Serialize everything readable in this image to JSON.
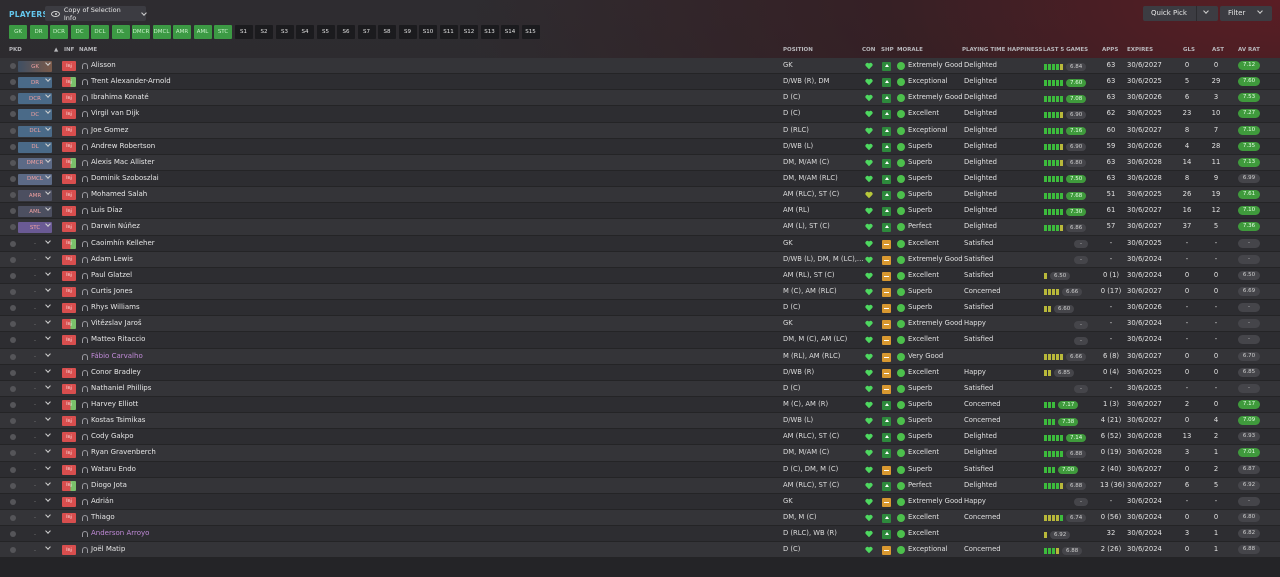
{
  "header": {
    "title": "PLAYERS",
    "copy_selection": "Copy of Selection Info",
    "quick_pick": "Quick Pick",
    "filter": "Filter"
  },
  "chips": [
    {
      "label": "GK",
      "active": true
    },
    {
      "label": "DR",
      "active": true
    },
    {
      "label": "DCR",
      "active": true
    },
    {
      "label": "DC",
      "active": true
    },
    {
      "label": "DCL",
      "active": true
    },
    {
      "label": "DL",
      "active": true
    },
    {
      "label": "DMCR",
      "active": true
    },
    {
      "label": "DMCL",
      "active": true
    },
    {
      "label": "AMR",
      "active": true
    },
    {
      "label": "AML",
      "active": true
    },
    {
      "label": "STC",
      "active": true
    },
    {
      "label": "S1",
      "active": false
    },
    {
      "label": "S2",
      "active": false
    },
    {
      "label": "S3",
      "active": false
    },
    {
      "label": "S4",
      "active": false
    },
    {
      "label": "S5",
      "active": false
    },
    {
      "label": "S6",
      "active": false
    },
    {
      "label": "S7",
      "active": false
    },
    {
      "label": "S8",
      "active": false
    },
    {
      "label": "S9",
      "active": false
    },
    {
      "label": "S10",
      "active": false
    },
    {
      "label": "S11",
      "active": false
    },
    {
      "label": "S12",
      "active": false
    },
    {
      "label": "S13",
      "active": false
    },
    {
      "label": "S14",
      "active": false
    },
    {
      "label": "S15",
      "active": false
    }
  ],
  "columns": {
    "pkd": "PKD",
    "inf": "INF",
    "name": "NAME",
    "position": "POSITION",
    "con": "CON",
    "shp": "SHP",
    "morale": "MORALE",
    "pth": "PLAYING TIME HAPPINESS",
    "last5": "LAST 5 GAMES",
    "apps": "APPS",
    "expires": "EXPIRES",
    "gls": "GLS",
    "ast": "AST",
    "avrat": "AV RAT"
  },
  "players": [
    {
      "pkd": "GK",
      "pkdcls": "sel-gk",
      "inj": "Inj",
      "name": "Alisson",
      "position": "GK",
      "shp": "up",
      "morale": "Extremely Good",
      "pth": "Delighted",
      "bars": [
        "g",
        "g",
        "g",
        "g",
        "y"
      ],
      "avg": "6.84",
      "avgcls": "dk",
      "apps": "63",
      "expires": "30/6/2027",
      "gls": "0",
      "ast": "0",
      "avrat": "7.12",
      "avrcls": "gr"
    },
    {
      "pkd": "DR",
      "pkdcls": "sel-d",
      "inj": "Inj",
      "name": "Trent Alexander-Arnold",
      "position": "D/WB (R), DM",
      "shp": "up",
      "morale": "Exceptional",
      "pth": "Delighted",
      "bars": [
        "g",
        "g",
        "g",
        "g",
        "g"
      ],
      "avg": "7.60",
      "avgcls": "gr",
      "apps": "63",
      "expires": "30/6/2025",
      "gls": "5",
      "ast": "29",
      "avrat": "7.60",
      "avrcls": "gr"
    },
    {
      "pkd": "DCR",
      "pkdcls": "sel-d",
      "inj": "Inj",
      "name": "Ibrahima Konaté",
      "position": "D (C)",
      "shp": "up",
      "morale": "Extremely Good",
      "pth": "Delighted",
      "bars": [
        "g",
        "g",
        "g",
        "g",
        "g"
      ],
      "avg": "7.08",
      "avgcls": "gr",
      "apps": "63",
      "expires": "30/6/2026",
      "gls": "6",
      "ast": "3",
      "avrat": "7.53",
      "avrcls": "gr"
    },
    {
      "pkd": "DC",
      "pkdcls": "sel-d",
      "inj": "Inj",
      "name": "Virgil van Dijk",
      "position": "D (C)",
      "shp": "up",
      "morale": "Excellent",
      "pth": "Delighted",
      "bars": [
        "g",
        "g",
        "g",
        "g",
        "y"
      ],
      "avg": "6.90",
      "avgcls": "dk",
      "apps": "62",
      "expires": "30/6/2025",
      "gls": "23",
      "ast": "10",
      "avrat": "7.27",
      "avrcls": "gr"
    },
    {
      "pkd": "DCL",
      "pkdcls": "sel-d",
      "inj": "Inj",
      "name": "Joe Gomez",
      "position": "D (RLC)",
      "shp": "up",
      "morale": "Exceptional",
      "pth": "Delighted",
      "bars": [
        "g",
        "g",
        "g",
        "g",
        "g"
      ],
      "avg": "7.16",
      "avgcls": "gr",
      "apps": "60",
      "expires": "30/6/2027",
      "gls": "8",
      "ast": "7",
      "avrat": "7.10",
      "avrcls": "gr"
    },
    {
      "pkd": "DL",
      "pkdcls": "sel-d",
      "inj": "Inj",
      "name": "Andrew Robertson",
      "position": "D/WB (L)",
      "shp": "up",
      "morale": "Superb",
      "pth": "Delighted",
      "bars": [
        "g",
        "g",
        "g",
        "g",
        "y"
      ],
      "avg": "6.90",
      "avgcls": "dk",
      "apps": "59",
      "expires": "30/6/2026",
      "gls": "4",
      "ast": "28",
      "avrat": "7.35",
      "avrcls": "gr"
    },
    {
      "pkd": "DMCR",
      "pkdcls": "sel-m",
      "inj": "Inj",
      "name": "Alexis Mac Allister",
      "position": "DM, M/AM (C)",
      "shp": "up",
      "morale": "Superb",
      "pth": "Delighted",
      "bars": [
        "g",
        "g",
        "g",
        "g",
        "y"
      ],
      "avg": "6.80",
      "avgcls": "dk",
      "apps": "63",
      "expires": "30/6/2028",
      "gls": "14",
      "ast": "11",
      "avrat": "7.13",
      "avrcls": "gr"
    },
    {
      "pkd": "DMCL",
      "pkdcls": "sel-m",
      "inj": "Inj",
      "name": "Dominik Szoboszlai",
      "position": "DM, M/AM (RLC)",
      "shp": "up",
      "morale": "Superb",
      "pth": "Delighted",
      "bars": [
        "g",
        "g",
        "g",
        "g",
        "g"
      ],
      "avg": "7.50",
      "avgcls": "gr",
      "apps": "63",
      "expires": "30/6/2028",
      "gls": "8",
      "ast": "9",
      "avrat": "6.99",
      "avrcls": "dk"
    },
    {
      "pkd": "AMR",
      "pkdcls": "sel-a",
      "inj": "Inj",
      "name": "Mohamed Salah",
      "position": "AM (RLC), ST (C)",
      "shp": "neutral",
      "morale": "Superb",
      "pth": "Delighted",
      "bars": [
        "g",
        "g",
        "g",
        "g",
        "g"
      ],
      "avg": "7.68",
      "avgcls": "gr",
      "apps": "51",
      "expires": "30/6/2025",
      "gls": "26",
      "ast": "19",
      "avrat": "7.61",
      "avrcls": "gr"
    },
    {
      "pkd": "AML",
      "pkdcls": "sel-a",
      "inj": "Inj",
      "name": "Luis Díaz",
      "position": "AM (RL)",
      "shp": "up",
      "morale": "Superb",
      "pth": "Delighted",
      "bars": [
        "g",
        "g",
        "g",
        "g",
        "g"
      ],
      "avg": "7.30",
      "avgcls": "gr",
      "apps": "61",
      "expires": "30/6/2027",
      "gls": "16",
      "ast": "12",
      "avrat": "7.10",
      "avrcls": "gr"
    },
    {
      "pkd": "STC",
      "pkdcls": "sel-st",
      "inj": "Inj",
      "name": "Darwin Núñez",
      "position": "AM (L), ST (C)",
      "shp": "up",
      "morale": "Perfect",
      "pth": "Delighted",
      "bars": [
        "g",
        "g",
        "g",
        "g",
        "y"
      ],
      "avg": "6.86",
      "avgcls": "dk",
      "apps": "57",
      "expires": "30/6/2027",
      "gls": "37",
      "ast": "5",
      "avrat": "7.36",
      "avrcls": "gr"
    },
    {
      "pkd": "-",
      "pkdcls": "empty",
      "inj": "Inj",
      "name": "Caoimhín Kelleher",
      "position": "GK",
      "shp": "dn",
      "morale": "Excellent",
      "pth": "Satisfied",
      "bars": [],
      "avg": "-",
      "avgcls": "dk",
      "apps": "-",
      "expires": "30/6/2025",
      "gls": "-",
      "ast": "-",
      "avrat": "-",
      "avrcls": "none"
    },
    {
      "pkd": "-",
      "pkdcls": "empty",
      "inj": "Inj",
      "name": "Adam Lewis",
      "position": "D/WB (L), DM, M (LC),...",
      "shp": "dn",
      "morale": "Extremely Good",
      "pth": "Satisfied",
      "bars": [],
      "avg": "-",
      "avgcls": "dk",
      "apps": "-",
      "expires": "30/6/2024",
      "gls": "-",
      "ast": "-",
      "avrat": "-",
      "avrcls": "none"
    },
    {
      "pkd": "-",
      "pkdcls": "empty",
      "inj": "Inj",
      "name": "Paul Glatzel",
      "position": "AM (RL), ST (C)",
      "shp": "dn",
      "morale": "Excellent",
      "pth": "Satisfied",
      "bars": [
        "y"
      ],
      "avg": "6.50",
      "avgcls": "dk",
      "apps": "0 (1)",
      "expires": "30/6/2024",
      "gls": "0",
      "ast": "0",
      "avrat": "6.50",
      "avrcls": "dk"
    },
    {
      "pkd": "-",
      "pkdcls": "empty",
      "inj": "Inj",
      "name": "Curtis Jones",
      "position": "M (C), AM (RLC)",
      "shp": "dn",
      "morale": "Superb",
      "pth": "Concerned",
      "bars": [
        "y",
        "y",
        "y",
        "y"
      ],
      "avg": "6.66",
      "avgcls": "dk",
      "apps": "0 (17)",
      "expires": "30/6/2027",
      "gls": "0",
      "ast": "0",
      "avrat": "6.69",
      "avrcls": "dk"
    },
    {
      "pkd": "-",
      "pkdcls": "empty",
      "inj": "Inj",
      "name": "Rhys Williams",
      "position": "D (C)",
      "shp": "dn",
      "morale": "Superb",
      "pth": "Satisfied",
      "bars": [
        "y",
        "y"
      ],
      "avg": "6.60",
      "avgcls": "dk",
      "apps": "-",
      "expires": "30/6/2026",
      "gls": "-",
      "ast": "-",
      "avrat": "-",
      "avrcls": "none"
    },
    {
      "pkd": "-",
      "pkdcls": "empty",
      "inj": "Inj",
      "name": "Vitězslav Jaroš",
      "position": "GK",
      "shp": "dn",
      "morale": "Extremely Good",
      "pth": "Happy",
      "bars": [],
      "avg": "-",
      "avgcls": "dk",
      "apps": "-",
      "expires": "30/6/2024",
      "gls": "-",
      "ast": "-",
      "avrat": "-",
      "avrcls": "none"
    },
    {
      "pkd": "-",
      "pkdcls": "empty",
      "inj": "Inj",
      "name": "Matteo Ritaccio",
      "position": "DM, M (C), AM (LC)",
      "shp": "dn",
      "morale": "Excellent",
      "pth": "Satisfied",
      "bars": [],
      "avg": "-",
      "avgcls": "dk",
      "apps": "-",
      "expires": "30/6/2024",
      "gls": "-",
      "ast": "-",
      "avrat": "-",
      "avrcls": "none"
    },
    {
      "pkd": "-",
      "pkdcls": "empty",
      "inj": "",
      "name": "Fábio Carvalho",
      "loan": true,
      "position": "M (RL), AM (RLC)",
      "shp": "dn",
      "morale": "Very Good",
      "pth": "",
      "bars": [
        "y",
        "y",
        "y",
        "y",
        "y"
      ],
      "avg": "6.66",
      "avgcls": "dk",
      "apps": "6 (8)",
      "expires": "30/6/2027",
      "gls": "0",
      "ast": "0",
      "avrat": "6.70",
      "avrcls": "dk"
    },
    {
      "pkd": "-",
      "pkdcls": "empty",
      "inj": "Inj",
      "name": "Conor Bradley",
      "position": "D/WB (R)",
      "shp": "dn",
      "morale": "Excellent",
      "pth": "Happy",
      "bars": [
        "y",
        "y"
      ],
      "avg": "6.85",
      "avgcls": "dk",
      "apps": "0 (4)",
      "expires": "30/6/2025",
      "gls": "0",
      "ast": "0",
      "avrat": "6.85",
      "avrcls": "dk"
    },
    {
      "pkd": "-",
      "pkdcls": "empty",
      "inj": "Inj",
      "name": "Nathaniel Phillips",
      "position": "D (C)",
      "shp": "dn",
      "morale": "Superb",
      "pth": "Satisfied",
      "bars": [],
      "avg": "-",
      "avgcls": "dk",
      "apps": "-",
      "expires": "30/6/2025",
      "gls": "-",
      "ast": "-",
      "avrat": "-",
      "avrcls": "none"
    },
    {
      "pkd": "-",
      "pkdcls": "empty",
      "inj": "Inj",
      "name": "Harvey Elliott",
      "position": "M (C), AM (R)",
      "shp": "up",
      "morale": "Superb",
      "pth": "Concerned",
      "bars": [
        "g",
        "g",
        "g"
      ],
      "avg": "7.17",
      "avgcls": "gr",
      "apps": "1 (3)",
      "expires": "30/6/2027",
      "gls": "2",
      "ast": "0",
      "avrat": "7.17",
      "avrcls": "gr"
    },
    {
      "pkd": "-",
      "pkdcls": "empty",
      "inj": "Inj",
      "name": "Kostas Tsimikas",
      "position": "D/WB (L)",
      "shp": "up",
      "morale": "Superb",
      "pth": "Concerned",
      "bars": [
        "g",
        "g",
        "g"
      ],
      "avg": "7.38",
      "avgcls": "gr",
      "apps": "4 (21)",
      "expires": "30/6/2027",
      "gls": "0",
      "ast": "4",
      "avrat": "7.09",
      "avrcls": "gr"
    },
    {
      "pkd": "-",
      "pkdcls": "empty",
      "inj": "Inj",
      "name": "Cody Gakpo",
      "position": "AM (RLC), ST (C)",
      "shp": "up",
      "morale": "Superb",
      "pth": "Delighted",
      "bars": [
        "g",
        "g",
        "g",
        "g",
        "g"
      ],
      "avg": "7.14",
      "avgcls": "gr",
      "apps": "6 (52)",
      "expires": "30/6/2028",
      "gls": "13",
      "ast": "2",
      "avrat": "6.93",
      "avrcls": "dk"
    },
    {
      "pkd": "-",
      "pkdcls": "empty",
      "inj": "Inj",
      "name": "Ryan Gravenberch",
      "position": "DM, M/AM (C)",
      "shp": "up",
      "morale": "Excellent",
      "pth": "Delighted",
      "bars": [
        "g",
        "g",
        "g",
        "g",
        "g"
      ],
      "avg": "6.88",
      "avgcls": "dk",
      "apps": "0 (19)",
      "expires": "30/6/2028",
      "gls": "3",
      "ast": "1",
      "avrat": "7.01",
      "avrcls": "gr"
    },
    {
      "pkd": "-",
      "pkdcls": "empty",
      "inj": "Inj",
      "name": "Wataru Endo",
      "position": "D (C), DM, M (C)",
      "shp": "dn",
      "morale": "Superb",
      "pth": "Satisfied",
      "bars": [
        "g",
        "g",
        "g"
      ],
      "avg": "7.00",
      "avgcls": "gr",
      "apps": "2 (40)",
      "expires": "30/6/2027",
      "gls": "0",
      "ast": "2",
      "avrat": "6.87",
      "avrcls": "dk"
    },
    {
      "pkd": "-",
      "pkdcls": "empty",
      "inj": "Inj",
      "name": "Diogo Jota",
      "position": "AM (RLC), ST (C)",
      "shp": "up",
      "morale": "Perfect",
      "pth": "Delighted",
      "bars": [
        "g",
        "g",
        "g",
        "g",
        "y"
      ],
      "avg": "6.88",
      "avgcls": "dk",
      "apps": "13 (36)",
      "expires": "30/6/2027",
      "gls": "6",
      "ast": "5",
      "avrat": "6.92",
      "avrcls": "dk"
    },
    {
      "pkd": "-",
      "pkdcls": "empty",
      "inj": "Inj",
      "name": "Adrián",
      "position": "GK",
      "shp": "dn",
      "morale": "Extremely Good",
      "pth": "Happy",
      "bars": [],
      "avg": "-",
      "avgcls": "dk",
      "apps": "-",
      "expires": "30/6/2024",
      "gls": "-",
      "ast": "-",
      "avrat": "-",
      "avrcls": "none"
    },
    {
      "pkd": "-",
      "pkdcls": "empty",
      "inj": "Inj",
      "name": "Thiago",
      "position": "DM, M (C)",
      "shp": "up",
      "morale": "Excellent",
      "pth": "Concerned",
      "bars": [
        "y",
        "y",
        "y",
        "y",
        "g"
      ],
      "avg": "6.74",
      "avgcls": "dk",
      "apps": "0 (56)",
      "expires": "30/6/2024",
      "gls": "0",
      "ast": "0",
      "avrat": "6.80",
      "avrcls": "dk"
    },
    {
      "pkd": "-",
      "pkdcls": "empty",
      "inj": "",
      "name": "Anderson Arroyo",
      "loan": true,
      "position": "D (RLC), WB (R)",
      "shp": "up",
      "morale": "Excellent",
      "pth": "",
      "bars": [
        "y"
      ],
      "avg": "6.92",
      "avgcls": "dk",
      "apps": "32",
      "expires": "30/6/2024",
      "gls": "3",
      "ast": "1",
      "avrat": "6.82",
      "avrcls": "dk"
    },
    {
      "pkd": "-",
      "pkdcls": "empty",
      "inj": "Inj",
      "name": "Joël Matip",
      "position": "D (C)",
      "shp": "dn",
      "morale": "Exceptional",
      "pth": "Concerned",
      "bars": [
        "g",
        "g",
        "g",
        "y"
      ],
      "avg": "6.88",
      "avgcls": "dk",
      "apps": "2 (26)",
      "expires": "30/6/2024",
      "gls": "0",
      "ast": "1",
      "avrat": "6.88",
      "avrcls": "dk"
    }
  ]
}
